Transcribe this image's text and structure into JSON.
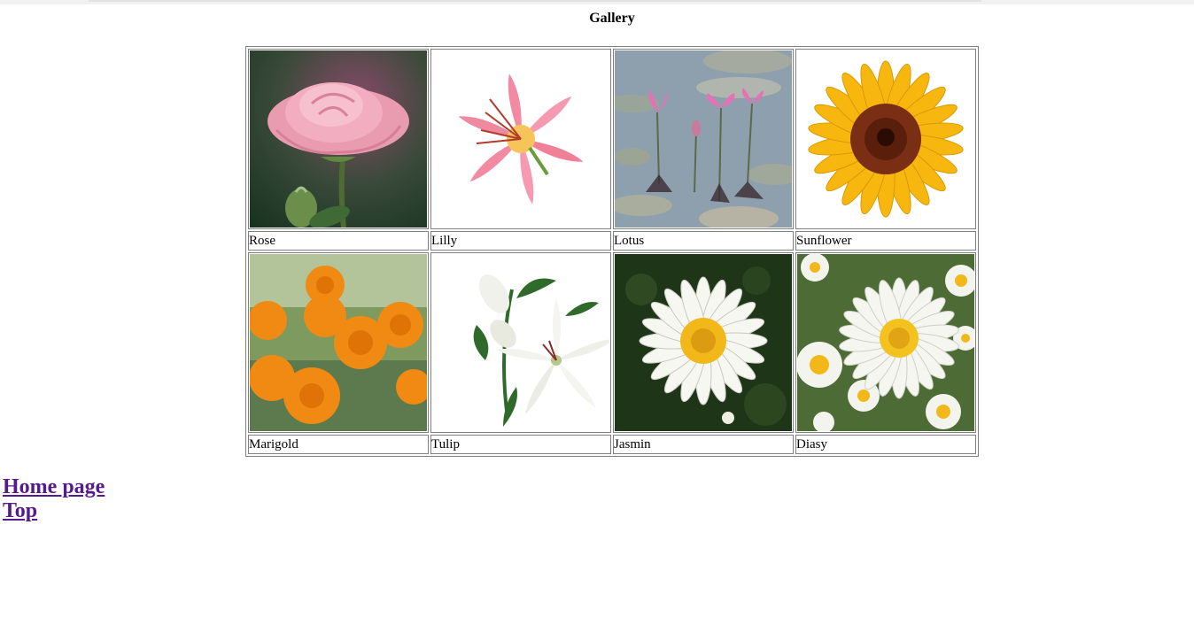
{
  "page": {
    "title": "Gallery"
  },
  "gallery": {
    "rows": [
      {
        "images": [
          {
            "flower": "rose",
            "caption": "Rose"
          },
          {
            "flower": "lilly",
            "caption": "Lilly"
          },
          {
            "flower": "lotus",
            "caption": "Lotus"
          },
          {
            "flower": "sunflower",
            "caption": "Sunflower"
          }
        ]
      },
      {
        "images": [
          {
            "flower": "marigold",
            "caption": "Marigold"
          },
          {
            "flower": "tulip",
            "caption": "Tulip"
          },
          {
            "flower": "jasmin",
            "caption": "Jasmin"
          },
          {
            "flower": "diasy",
            "caption": "Diasy"
          }
        ]
      }
    ]
  },
  "links": {
    "home": "Home page",
    "top": "Top"
  },
  "colors": {
    "link_visited": "#551a8b",
    "table_border": "#808080"
  }
}
